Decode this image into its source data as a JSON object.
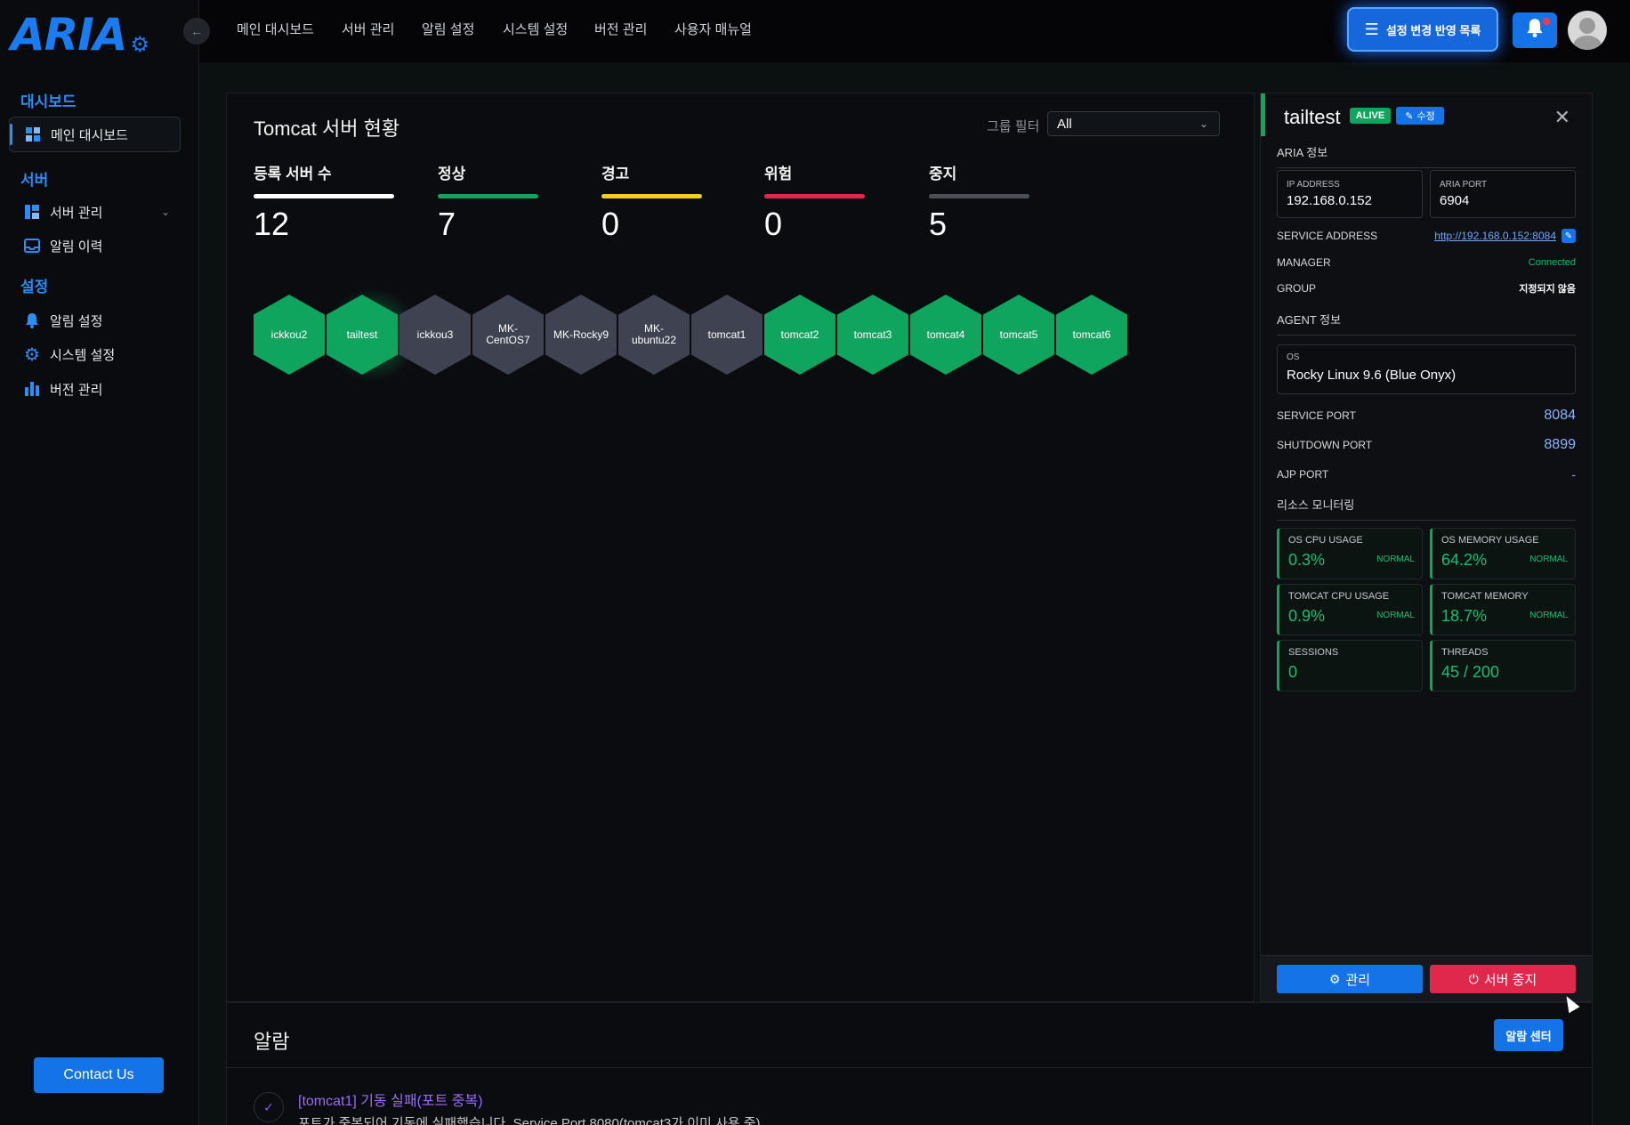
{
  "brand": {
    "logo_text": "ARIA",
    "accent": "#1a7cf0"
  },
  "topnav": {
    "items": [
      "메인 대시보드",
      "서버 관리",
      "알림 설정",
      "시스템 설정",
      "버전 관리",
      "사용자 매뉴얼"
    ],
    "settings_button": "설정 변경 반영 목록"
  },
  "sidebar": {
    "sections": [
      {
        "title": "대시보드",
        "items": [
          {
            "label": "메인 대시보드",
            "icon": "grid-icon",
            "active": true
          }
        ]
      },
      {
        "title": "서버",
        "items": [
          {
            "label": "서버 관리",
            "icon": "server-icon"
          },
          {
            "label": "알림 이력",
            "icon": "inbox-icon"
          }
        ]
      },
      {
        "title": "설정",
        "items": [
          {
            "label": "알림 설정",
            "icon": "bell-icon"
          },
          {
            "label": "시스템 설정",
            "icon": "gear-icon"
          },
          {
            "label": "버전 관리",
            "icon": "bar-chart-icon"
          }
        ]
      }
    ],
    "contact": "Contact Us"
  },
  "dashboard": {
    "title": "Tomcat 서버 현황",
    "group_filter_label": "그룹 필터",
    "group_filter_value": "All",
    "stats": [
      {
        "label": "등록 서버 수",
        "value": "12",
        "color": "#ffffff"
      },
      {
        "label": "정상",
        "value": "7",
        "color": "#0fa55e"
      },
      {
        "label": "경고",
        "value": "0",
        "color": "#f2d020"
      },
      {
        "label": "위험",
        "value": "0",
        "color": "#e0284c"
      },
      {
        "label": "중지",
        "value": "5",
        "color": "#4a4f58"
      }
    ],
    "servers": [
      {
        "name": "ickkou2",
        "status": "green"
      },
      {
        "name": "tailtest",
        "status": "green",
        "selected": true
      },
      {
        "name": "ickkou3",
        "status": "gray"
      },
      {
        "name": "MK-CentOS7",
        "status": "gray"
      },
      {
        "name": "MK-Rocky9",
        "status": "gray"
      },
      {
        "name": "MK-ubuntu22",
        "status": "gray"
      },
      {
        "name": "tomcat1",
        "status": "gray"
      },
      {
        "name": "tomcat2",
        "status": "green"
      },
      {
        "name": "tomcat3",
        "status": "green"
      },
      {
        "name": "tomcat4",
        "status": "green"
      },
      {
        "name": "tomcat5",
        "status": "green"
      },
      {
        "name": "tomcat6",
        "status": "green"
      }
    ]
  },
  "alarm": {
    "title": "알람",
    "center_button": "알람 센터",
    "item_title": "[tomcat1] 기동 실패(포트 중복)",
    "item_desc": "포트가 중복되어 기동에 실패했습니다. Service Port 8080(tomcat3가 이미 사용 중)"
  },
  "detail": {
    "name": "tailtest",
    "status_badge": "ALIVE",
    "edit_label": "수정",
    "aria_section": "ARIA 정보",
    "ip_label": "IP ADDRESS",
    "ip_value": "192.168.0.152",
    "port_label": "ARIA PORT",
    "port_value": "6904",
    "service_address_label": "SERVICE ADDRESS",
    "service_address_value": "http://192.168.0.152:8084",
    "manager_label": "MANAGER",
    "manager_value": "Connected",
    "group_label": "GROUP",
    "group_value": "지정되지 않음",
    "agent_section": "AGENT 정보",
    "os_label": "OS",
    "os_value": "Rocky Linux 9.6 (Blue Onyx)",
    "service_port_label": "SERVICE PORT",
    "service_port_value": "8084",
    "shutdown_port_label": "SHUTDOWN PORT",
    "shutdown_port_value": "8899",
    "ajp_port_label": "AJP PORT",
    "ajp_port_value": "-",
    "resource_section": "리소스 모니터링",
    "resources": [
      {
        "label": "OS CPU USAGE",
        "value": "0.3%",
        "status": "NORMAL"
      },
      {
        "label": "OS MEMORY USAGE",
        "value": "64.2%",
        "status": "NORMAL"
      },
      {
        "label": "TOMCAT CPU USAGE",
        "value": "0.9%",
        "status": "NORMAL"
      },
      {
        "label": "TOMCAT MEMORY",
        "value": "18.7%",
        "status": "NORMAL"
      },
      {
        "label": "SESSIONS",
        "value": "0",
        "status": ""
      },
      {
        "label": "THREADS",
        "value": "45 / 200",
        "status": ""
      }
    ],
    "manage_button": "관리",
    "stop_button": "서버 중지"
  }
}
